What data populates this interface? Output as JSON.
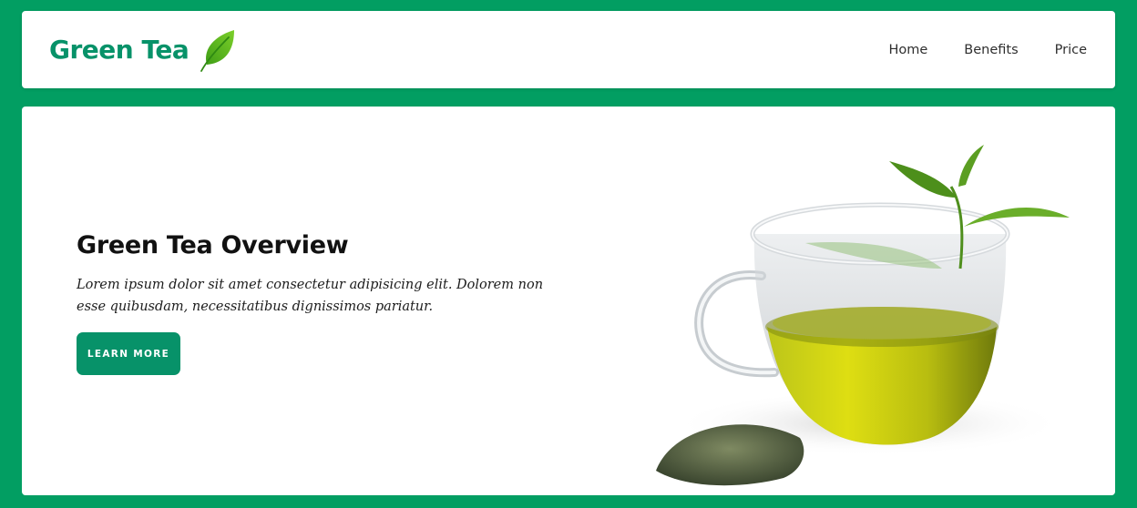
{
  "navbar": {
    "brand": "Green Tea",
    "brand_icon": "leaf-icon",
    "links": [
      {
        "label": "Home"
      },
      {
        "label": "Benefits"
      },
      {
        "label": "Price"
      }
    ]
  },
  "hero": {
    "title": "Green Tea Overview",
    "description": "Lorem ipsum dolor sit amet consectetur adipisicing elit. Dolorem non esse quibusdam, necessitatibus dignissimos pariatur.",
    "cta_label": "LEARN MORE",
    "image": "green-tea-cup-image"
  },
  "colors": {
    "page_background": "#029e62",
    "brand": "#079269",
    "button": "#079269",
    "card": "#ffffff"
  }
}
